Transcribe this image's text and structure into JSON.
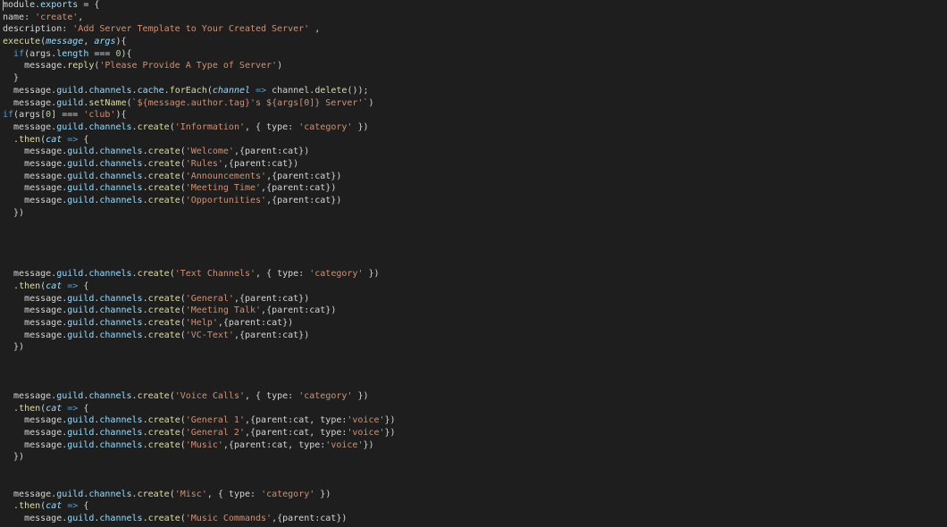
{
  "colors": {
    "background": "#1e1e1e",
    "keyword": "#569cd6",
    "string": "#ce9178",
    "function": "#dcdcaa",
    "property": "#9cdcfe",
    "parameter": "#9cdcfe",
    "plain": "#d4d4d4",
    "number": "#b5cea8"
  },
  "lines": [
    [
      [
        "pl",
        "module"
      ],
      [
        "pl",
        "."
      ],
      [
        "pr",
        "exports"
      ],
      [
        "pl",
        " = {"
      ]
    ],
    [
      [
        "pl",
        "name: "
      ],
      [
        "str",
        "'create'"
      ],
      [
        "pl",
        ","
      ]
    ],
    [
      [
        "pl",
        "description: "
      ],
      [
        "str",
        "'Add Server Template to Your Created Server'"
      ],
      [
        "pl",
        " ,"
      ]
    ],
    [
      [
        "fn",
        "execute"
      ],
      [
        "pl",
        "("
      ],
      [
        "par",
        "message"
      ],
      [
        "pl",
        ", "
      ],
      [
        "par",
        "args"
      ],
      [
        "pl",
        "){"
      ]
    ],
    [
      [
        "pl",
        "  "
      ],
      [
        "kw",
        "if"
      ],
      [
        "pl",
        "(args."
      ],
      [
        "pr",
        "length"
      ],
      [
        "pl",
        " === "
      ],
      [
        "num",
        "0"
      ],
      [
        "pl",
        "){"
      ]
    ],
    [
      [
        "pl",
        "    message."
      ],
      [
        "fn",
        "reply"
      ],
      [
        "pl",
        "("
      ],
      [
        "str",
        "'Please Provide A Type of Server'"
      ],
      [
        "pl",
        ")"
      ]
    ],
    [
      [
        "pl",
        "  }"
      ]
    ],
    [
      [
        "pl",
        "  message."
      ],
      [
        "pr",
        "guild"
      ],
      [
        "pl",
        "."
      ],
      [
        "pr",
        "channels"
      ],
      [
        "pl",
        "."
      ],
      [
        "pr",
        "cache"
      ],
      [
        "pl",
        "."
      ],
      [
        "fn",
        "forEach"
      ],
      [
        "pl",
        "("
      ],
      [
        "par",
        "channel"
      ],
      [
        "pl",
        " "
      ],
      [
        "kw",
        "=>"
      ],
      [
        "pl",
        " channel."
      ],
      [
        "fn",
        "delete"
      ],
      [
        "pl",
        "());"
      ]
    ],
    [
      [
        "pl",
        "  message."
      ],
      [
        "pr",
        "guild"
      ],
      [
        "pl",
        "."
      ],
      [
        "fn",
        "setName"
      ],
      [
        "pl",
        "("
      ],
      [
        "str",
        "`${message.author.tag}'s ${args[0]} Server'`"
      ],
      [
        "pl",
        ")"
      ]
    ],
    [
      [
        "kw",
        "if"
      ],
      [
        "pl",
        "(args["
      ],
      [
        "num",
        "0"
      ],
      [
        "pl",
        "] === "
      ],
      [
        "str",
        "'club'"
      ],
      [
        "pl",
        "){"
      ]
    ],
    [
      [
        "pl",
        "  message."
      ],
      [
        "pr",
        "guild"
      ],
      [
        "pl",
        "."
      ],
      [
        "pr",
        "channels"
      ],
      [
        "pl",
        "."
      ],
      [
        "fn",
        "create"
      ],
      [
        "pl",
        "("
      ],
      [
        "str",
        "'Information'"
      ],
      [
        "pl",
        ", { type: "
      ],
      [
        "str",
        "'category'"
      ],
      [
        "pl",
        " })"
      ]
    ],
    [
      [
        "pl",
        "  ."
      ],
      [
        "fn",
        "then"
      ],
      [
        "pl",
        "("
      ],
      [
        "par",
        "cat"
      ],
      [
        "pl",
        " "
      ],
      [
        "kw",
        "=>"
      ],
      [
        "pl",
        " {"
      ]
    ],
    [
      [
        "pl",
        "    message."
      ],
      [
        "pr",
        "guild"
      ],
      [
        "pl",
        "."
      ],
      [
        "pr",
        "channels"
      ],
      [
        "pl",
        "."
      ],
      [
        "fn",
        "create"
      ],
      [
        "pl",
        "("
      ],
      [
        "str",
        "'Welcome'"
      ],
      [
        "pl",
        ",{parent:cat})"
      ]
    ],
    [
      [
        "pl",
        "    message."
      ],
      [
        "pr",
        "guild"
      ],
      [
        "pl",
        "."
      ],
      [
        "pr",
        "channels"
      ],
      [
        "pl",
        "."
      ],
      [
        "fn",
        "create"
      ],
      [
        "pl",
        "("
      ],
      [
        "str",
        "'Rules'"
      ],
      [
        "pl",
        ",{parent:cat})"
      ]
    ],
    [
      [
        "pl",
        "    message."
      ],
      [
        "pr",
        "guild"
      ],
      [
        "pl",
        "."
      ],
      [
        "pr",
        "channels"
      ],
      [
        "pl",
        "."
      ],
      [
        "fn",
        "create"
      ],
      [
        "pl",
        "("
      ],
      [
        "str",
        "'Announcements'"
      ],
      [
        "pl",
        ",{parent:cat})"
      ]
    ],
    [
      [
        "pl",
        "    message."
      ],
      [
        "pr",
        "guild"
      ],
      [
        "pl",
        "."
      ],
      [
        "pr",
        "channels"
      ],
      [
        "pl",
        "."
      ],
      [
        "fn",
        "create"
      ],
      [
        "pl",
        "("
      ],
      [
        "str",
        "'Meeting Time'"
      ],
      [
        "pl",
        ",{parent:cat})"
      ]
    ],
    [
      [
        "pl",
        "    message."
      ],
      [
        "pr",
        "guild"
      ],
      [
        "pl",
        "."
      ],
      [
        "pr",
        "channels"
      ],
      [
        "pl",
        "."
      ],
      [
        "fn",
        "create"
      ],
      [
        "pl",
        "("
      ],
      [
        "str",
        "'Opportunities'"
      ],
      [
        "pl",
        ",{parent:cat})"
      ]
    ],
    [
      [
        "pl",
        "  })"
      ]
    ],
    [],
    [],
    [],
    [],
    [
      [
        "pl",
        "  message."
      ],
      [
        "pr",
        "guild"
      ],
      [
        "pl",
        "."
      ],
      [
        "pr",
        "channels"
      ],
      [
        "pl",
        "."
      ],
      [
        "fn",
        "create"
      ],
      [
        "pl",
        "("
      ],
      [
        "str",
        "'Text Channels'"
      ],
      [
        "pl",
        ", { type: "
      ],
      [
        "str",
        "'category'"
      ],
      [
        "pl",
        " })"
      ]
    ],
    [
      [
        "pl",
        "  ."
      ],
      [
        "fn",
        "then"
      ],
      [
        "pl",
        "("
      ],
      [
        "par",
        "cat"
      ],
      [
        "pl",
        " "
      ],
      [
        "kw",
        "=>"
      ],
      [
        "pl",
        " {"
      ]
    ],
    [
      [
        "pl",
        "    message."
      ],
      [
        "pr",
        "guild"
      ],
      [
        "pl",
        "."
      ],
      [
        "pr",
        "channels"
      ],
      [
        "pl",
        "."
      ],
      [
        "fn",
        "create"
      ],
      [
        "pl",
        "("
      ],
      [
        "str",
        "'General'"
      ],
      [
        "pl",
        ",{parent:cat})"
      ]
    ],
    [
      [
        "pl",
        "    message."
      ],
      [
        "pr",
        "guild"
      ],
      [
        "pl",
        "."
      ],
      [
        "pr",
        "channels"
      ],
      [
        "pl",
        "."
      ],
      [
        "fn",
        "create"
      ],
      [
        "pl",
        "("
      ],
      [
        "str",
        "'Meeting Talk'"
      ],
      [
        "pl",
        ",{parent:cat})"
      ]
    ],
    [
      [
        "pl",
        "    message."
      ],
      [
        "pr",
        "guild"
      ],
      [
        "pl",
        "."
      ],
      [
        "pr",
        "channels"
      ],
      [
        "pl",
        "."
      ],
      [
        "fn",
        "create"
      ],
      [
        "pl",
        "("
      ],
      [
        "str",
        "'Help'"
      ],
      [
        "pl",
        ",{parent:cat})"
      ]
    ],
    [
      [
        "pl",
        "    message."
      ],
      [
        "pr",
        "guild"
      ],
      [
        "pl",
        "."
      ],
      [
        "pr",
        "channels"
      ],
      [
        "pl",
        "."
      ],
      [
        "fn",
        "create"
      ],
      [
        "pl",
        "("
      ],
      [
        "str",
        "'VC-Text'"
      ],
      [
        "pl",
        ",{parent:cat})"
      ]
    ],
    [
      [
        "pl",
        "  })"
      ]
    ],
    [],
    [],
    [],
    [
      [
        "pl",
        "  message."
      ],
      [
        "pr",
        "guild"
      ],
      [
        "pl",
        "."
      ],
      [
        "pr",
        "channels"
      ],
      [
        "pl",
        "."
      ],
      [
        "fn",
        "create"
      ],
      [
        "pl",
        "("
      ],
      [
        "str",
        "'Voice Calls'"
      ],
      [
        "pl",
        ", { type: "
      ],
      [
        "str",
        "'category'"
      ],
      [
        "pl",
        " })"
      ]
    ],
    [
      [
        "pl",
        "  ."
      ],
      [
        "fn",
        "then"
      ],
      [
        "pl",
        "("
      ],
      [
        "par",
        "cat"
      ],
      [
        "pl",
        " "
      ],
      [
        "kw",
        "=>"
      ],
      [
        "pl",
        " {"
      ]
    ],
    [
      [
        "pl",
        "    message."
      ],
      [
        "pr",
        "guild"
      ],
      [
        "pl",
        "."
      ],
      [
        "pr",
        "channels"
      ],
      [
        "pl",
        "."
      ],
      [
        "fn",
        "create"
      ],
      [
        "pl",
        "("
      ],
      [
        "str",
        "'General 1'"
      ],
      [
        "pl",
        ",{parent:cat, type:"
      ],
      [
        "str",
        "'voice'"
      ],
      [
        "pl",
        "})"
      ]
    ],
    [
      [
        "pl",
        "    message."
      ],
      [
        "pr",
        "guild"
      ],
      [
        "pl",
        "."
      ],
      [
        "pr",
        "channels"
      ],
      [
        "pl",
        "."
      ],
      [
        "fn",
        "create"
      ],
      [
        "pl",
        "("
      ],
      [
        "str",
        "'General 2'"
      ],
      [
        "pl",
        ",{parent:cat, type:"
      ],
      [
        "str",
        "'voice'"
      ],
      [
        "pl",
        "})"
      ]
    ],
    [
      [
        "pl",
        "    message."
      ],
      [
        "pr",
        "guild"
      ],
      [
        "pl",
        "."
      ],
      [
        "pr",
        "channels"
      ],
      [
        "pl",
        "."
      ],
      [
        "fn",
        "create"
      ],
      [
        "pl",
        "("
      ],
      [
        "str",
        "'Music'"
      ],
      [
        "pl",
        ",{parent:cat, type:"
      ],
      [
        "str",
        "'voice'"
      ],
      [
        "pl",
        "})"
      ]
    ],
    [
      [
        "pl",
        "  })"
      ]
    ],
    [],
    [],
    [
      [
        "pl",
        "  message."
      ],
      [
        "pr",
        "guild"
      ],
      [
        "pl",
        "."
      ],
      [
        "pr",
        "channels"
      ],
      [
        "pl",
        "."
      ],
      [
        "fn",
        "create"
      ],
      [
        "pl",
        "("
      ],
      [
        "str",
        "'Misc'"
      ],
      [
        "pl",
        ", { type: "
      ],
      [
        "str",
        "'category'"
      ],
      [
        "pl",
        " })"
      ]
    ],
    [
      [
        "pl",
        "  ."
      ],
      [
        "fn",
        "then"
      ],
      [
        "pl",
        "("
      ],
      [
        "par",
        "cat"
      ],
      [
        "pl",
        " "
      ],
      [
        "kw",
        "=>"
      ],
      [
        "pl",
        " {"
      ]
    ],
    [
      [
        "pl",
        "    message."
      ],
      [
        "pr",
        "guild"
      ],
      [
        "pl",
        "."
      ],
      [
        "pr",
        "channels"
      ],
      [
        "pl",
        "."
      ],
      [
        "fn",
        "create"
      ],
      [
        "pl",
        "("
      ],
      [
        "str",
        "'Music Commands'"
      ],
      [
        "pl",
        ",{parent:cat})"
      ]
    ]
  ]
}
